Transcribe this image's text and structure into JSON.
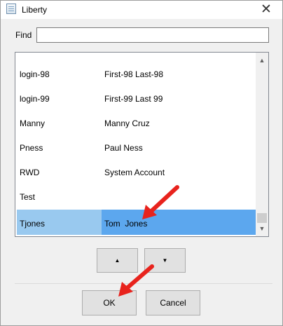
{
  "window": {
    "title": "Liberty",
    "close_glyph": "✕"
  },
  "find": {
    "label": "Find",
    "value": "",
    "placeholder": ""
  },
  "list": {
    "rows": [
      {
        "login": "login-98",
        "name": "First-98 Last-98",
        "selected": false
      },
      {
        "login": "login-99",
        "name": "First-99 Last 99",
        "selected": false
      },
      {
        "login": "Manny",
        "name": "Manny Cruz",
        "selected": false
      },
      {
        "login": "Pness",
        "name": "Paul Ness",
        "selected": false
      },
      {
        "login": "RWD",
        "name": "System Account",
        "selected": false
      },
      {
        "login": "Test",
        "name": "",
        "selected": false
      },
      {
        "login": "Tjones",
        "name": "Tom  Jones",
        "selected": true
      }
    ],
    "selection_colors": {
      "login_cell": "#99c9ef",
      "name_cell": "#5ca7ee"
    }
  },
  "scrollbar": {
    "up_glyph": "▲",
    "down_glyph": "▼"
  },
  "order_buttons": {
    "up_glyph": "▲",
    "down_glyph": "▼"
  },
  "dialog_buttons": {
    "ok_label": "OK",
    "cancel_label": "Cancel"
  },
  "annotations": {
    "arrow_color": "#e8231d",
    "arrows": [
      "red-arrow-pointing-to-tom-jones",
      "red-arrow-pointing-to-ok-button"
    ]
  }
}
